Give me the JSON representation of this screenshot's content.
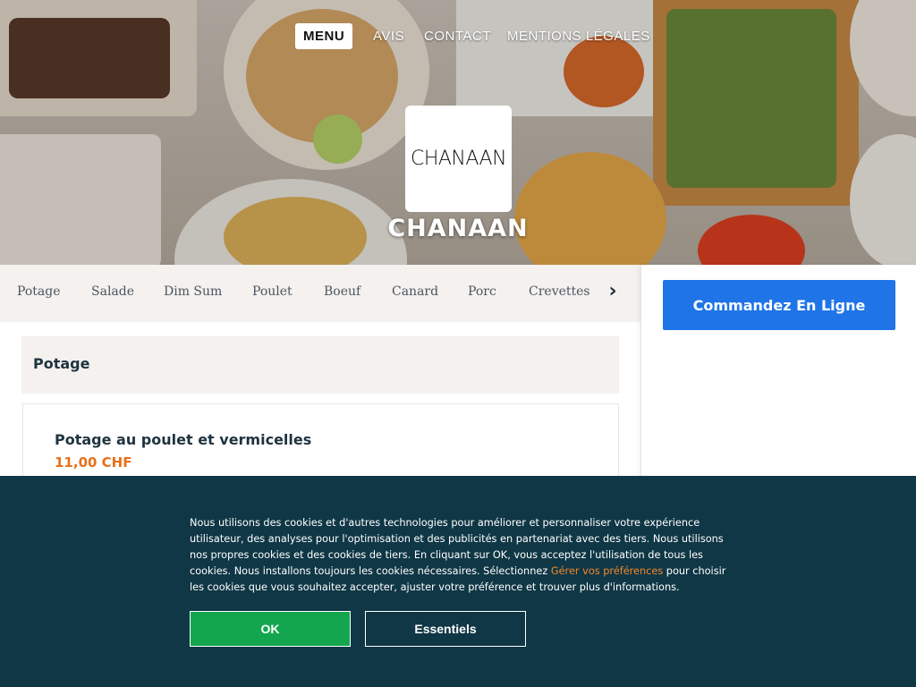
{
  "nav": {
    "items": [
      {
        "label": "MENU",
        "active": true
      },
      {
        "label": "AVIS",
        "active": false
      },
      {
        "label": "CONTACT",
        "active": false
      },
      {
        "label": "MENTIONS LÉGALES",
        "active": false
      }
    ]
  },
  "brand": {
    "logo_text": "CHANAAN",
    "title": "CHANAAN"
  },
  "categories": [
    "Potage",
    "Salade",
    "Dim Sum",
    "Poulet",
    "Boeuf",
    "Canard",
    "Porc",
    "Crevettes"
  ],
  "category_next_icon": "chevron-right-icon",
  "menu": {
    "section_title": "Potage",
    "dishes": [
      {
        "name": "Potage au poulet et vermicelles",
        "price": "11,00 CHF"
      }
    ]
  },
  "order": {
    "button_label": "Commandez En Ligne"
  },
  "cookie": {
    "text_before_link": "Nous utilisons des cookies et d'autres technologies pour améliorer et personnaliser votre expérience utilisateur, des analyses pour l'optimisation et des publicités en partenariat avec des tiers. Nous utilisons nos propres cookies et des cookies de tiers. En cliquant sur OK, vous acceptez l'utilisation de tous les cookies. Nous installons toujours les cookies nécessaires. Sélectionnez ",
    "link_text": "Gérer vos préférences",
    "text_after_link": " pour choisir les cookies que vous souhaitez accepter, ajuster votre préférence et trouver plus d'informations.",
    "ok_label": "OK",
    "essentials_label": "Essentiels"
  },
  "colors": {
    "order_button": "#1f74e8",
    "price": "#e8711a",
    "cookie_bg": "#103746",
    "cookie_link": "#f08a2b",
    "ok_button": "#14a64e"
  }
}
